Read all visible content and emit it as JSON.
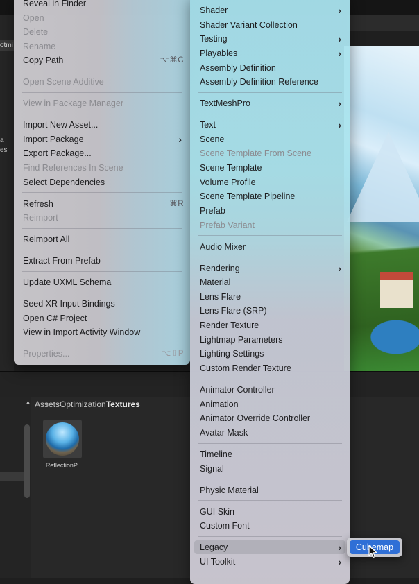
{
  "background": {
    "left_panel_texts": [
      "otmi",
      "a",
      "es"
    ],
    "breadcrumb": [
      "Assets",
      "Optimization",
      "Textures"
    ],
    "asset": {
      "label": "ReflectionP...",
      "icon": "reflection-probe-sphere-icon"
    }
  },
  "left_menu": {
    "items": [
      {
        "label": "Reveal in Finder",
        "enabled": true
      },
      {
        "label": "Open",
        "enabled": false
      },
      {
        "label": "Delete",
        "enabled": false
      },
      {
        "label": "Rename",
        "enabled": false
      },
      {
        "label": "Copy Path",
        "enabled": true,
        "shortcut": "⌥⌘C"
      },
      {
        "label": "Open Scene Additive",
        "enabled": false
      },
      {
        "label": "View in Package Manager",
        "enabled": false
      },
      {
        "label": "Import New Asset...",
        "enabled": true
      },
      {
        "label": "Import Package",
        "enabled": true,
        "submenu": true
      },
      {
        "label": "Export Package...",
        "enabled": true
      },
      {
        "label": "Find References In Scene",
        "enabled": false
      },
      {
        "label": "Select Dependencies",
        "enabled": true
      },
      {
        "label": "Refresh",
        "enabled": true,
        "shortcut": "⌘R"
      },
      {
        "label": "Reimport",
        "enabled": false
      },
      {
        "label": "Reimport All",
        "enabled": true
      },
      {
        "label": "Extract From Prefab",
        "enabled": true
      },
      {
        "label": "Update UXML Schema",
        "enabled": true
      },
      {
        "label": "Seed XR Input Bindings",
        "enabled": true
      },
      {
        "label": "Open C# Project",
        "enabled": true
      },
      {
        "label": "View in Import Activity Window",
        "enabled": true
      },
      {
        "label": "Properties...",
        "enabled": false,
        "shortcut": "⌥⇧P"
      }
    ]
  },
  "right_menu": {
    "items": [
      {
        "label": "Shader",
        "enabled": true,
        "submenu": true
      },
      {
        "label": "Shader Variant Collection",
        "enabled": true
      },
      {
        "label": "Testing",
        "enabled": true,
        "submenu": true
      },
      {
        "label": "Playables",
        "enabled": true,
        "submenu": true
      },
      {
        "label": "Assembly Definition",
        "enabled": true
      },
      {
        "label": "Assembly Definition Reference",
        "enabled": true
      },
      {
        "label": "TextMeshPro",
        "enabled": true,
        "submenu": true
      },
      {
        "label": "Text",
        "enabled": true,
        "submenu": true
      },
      {
        "label": "Scene",
        "enabled": true
      },
      {
        "label": "Scene Template From Scene",
        "enabled": false
      },
      {
        "label": "Scene Template",
        "enabled": true
      },
      {
        "label": "Volume Profile",
        "enabled": true
      },
      {
        "label": "Scene Template Pipeline",
        "enabled": true
      },
      {
        "label": "Prefab",
        "enabled": true
      },
      {
        "label": "Prefab Variant",
        "enabled": false
      },
      {
        "label": "Audio Mixer",
        "enabled": true
      },
      {
        "label": "Rendering",
        "enabled": true,
        "submenu": true
      },
      {
        "label": "Material",
        "enabled": true
      },
      {
        "label": "Lens Flare",
        "enabled": true
      },
      {
        "label": "Lens Flare (SRP)",
        "enabled": true
      },
      {
        "label": "Render Texture",
        "enabled": true
      },
      {
        "label": "Lightmap Parameters",
        "enabled": true
      },
      {
        "label": "Lighting Settings",
        "enabled": true
      },
      {
        "label": "Custom Render Texture",
        "enabled": true
      },
      {
        "label": "Animator Controller",
        "enabled": true
      },
      {
        "label": "Animation",
        "enabled": true
      },
      {
        "label": "Animator Override Controller",
        "enabled": true
      },
      {
        "label": "Avatar Mask",
        "enabled": true
      },
      {
        "label": "Timeline",
        "enabled": true
      },
      {
        "label": "Signal",
        "enabled": true
      },
      {
        "label": "Physic Material",
        "enabled": true
      },
      {
        "label": "GUI Skin",
        "enabled": true
      },
      {
        "label": "Custom Font",
        "enabled": true
      },
      {
        "label": "Legacy",
        "enabled": true,
        "submenu": true,
        "highlighted": true
      },
      {
        "label": "UI Toolkit",
        "enabled": true,
        "submenu": true
      }
    ]
  },
  "submenu": {
    "label": "Cubemap",
    "highlighted": true
  },
  "chevron": "›",
  "colors": {
    "highlight_blue": "#2f6fd6"
  }
}
